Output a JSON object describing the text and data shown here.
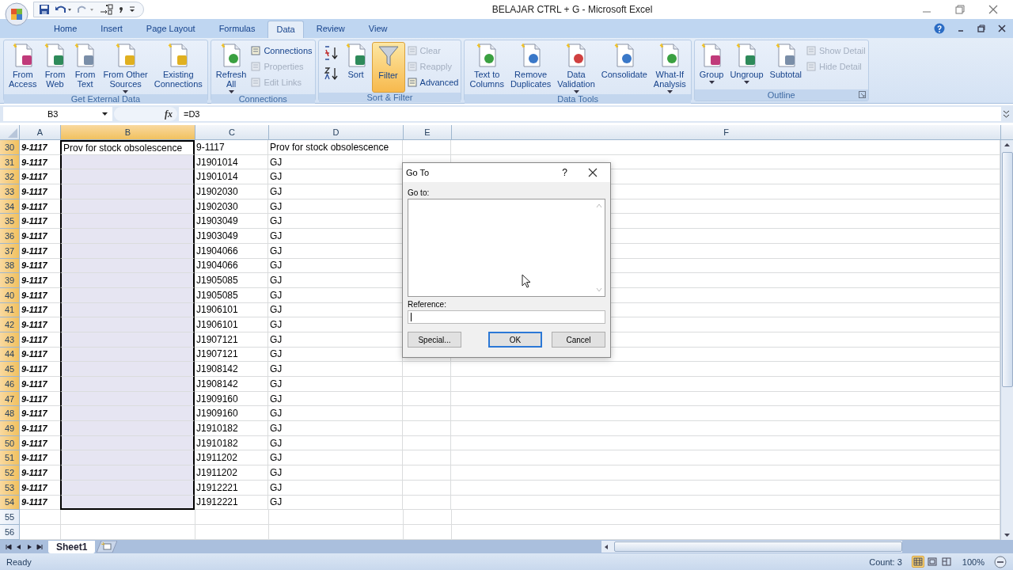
{
  "window": {
    "title": "BELAJAR CTRL + G - Microsoft Excel"
  },
  "tabs": [
    {
      "label": "Home",
      "selected": false
    },
    {
      "label": "Insert",
      "selected": false
    },
    {
      "label": "Page Layout",
      "selected": false
    },
    {
      "label": "Formulas",
      "selected": false
    },
    {
      "label": "Data",
      "selected": true
    },
    {
      "label": "Review",
      "selected": false
    },
    {
      "label": "View",
      "selected": false
    }
  ],
  "ribbon": [
    {
      "name": "Get External Data",
      "launcher": false,
      "items": [
        {
          "kind": "large",
          "lines": [
            "From",
            "Access"
          ],
          "dropdown": false
        },
        {
          "kind": "large",
          "lines": [
            "From",
            "Web"
          ],
          "dropdown": false
        },
        {
          "kind": "large",
          "lines": [
            "From",
            "Text"
          ],
          "dropdown": false
        },
        {
          "kind": "large",
          "lines": [
            "From Other",
            "Sources"
          ],
          "dropdown": true
        },
        {
          "kind": "large",
          "lines": [
            "Existing",
            "Connections"
          ],
          "dropdown": false
        }
      ]
    },
    {
      "name": "Connections",
      "launcher": false,
      "items": [
        {
          "kind": "large",
          "lines": [
            "Refresh",
            "All"
          ],
          "dropdown": true
        },
        {
          "kind": "stack",
          "entries": [
            {
              "label": "Connections",
              "disabled": false
            },
            {
              "label": "Properties",
              "disabled": true
            },
            {
              "label": "Edit Links",
              "disabled": true
            }
          ]
        }
      ]
    },
    {
      "name": "Sort & Filter",
      "launcher": false,
      "items": [
        {
          "kind": "sortpair"
        },
        {
          "kind": "large",
          "lines": [
            "Sort"
          ],
          "dropdown": false
        },
        {
          "kind": "toggle",
          "label": "Filter",
          "on": true
        },
        {
          "kind": "stack",
          "entries": [
            {
              "label": "Clear",
              "disabled": true
            },
            {
              "label": "Reapply",
              "disabled": true
            },
            {
              "label": "Advanced",
              "disabled": false
            }
          ]
        }
      ]
    },
    {
      "name": "Data Tools",
      "launcher": false,
      "items": [
        {
          "kind": "large",
          "lines": [
            "Text to",
            "Columns"
          ],
          "dropdown": false
        },
        {
          "kind": "large",
          "lines": [
            "Remove",
            "Duplicates"
          ],
          "dropdown": false
        },
        {
          "kind": "large",
          "lines": [
            "Data",
            "Validation"
          ],
          "dropdown": true
        },
        {
          "kind": "large",
          "lines": [
            "Consolidate"
          ],
          "dropdown": false
        },
        {
          "kind": "large",
          "lines": [
            "What-If",
            "Analysis"
          ],
          "dropdown": true
        }
      ]
    },
    {
      "name": "Outline",
      "launcher": true,
      "items": [
        {
          "kind": "large",
          "lines": [
            "Group"
          ],
          "dropdown": true
        },
        {
          "kind": "large",
          "lines": [
            "Ungroup"
          ],
          "dropdown": true
        },
        {
          "kind": "large",
          "lines": [
            "Subtotal"
          ],
          "dropdown": false
        },
        {
          "kind": "stack",
          "entries": [
            {
              "label": "Show Detail",
              "disabled": true
            },
            {
              "label": "Hide Detail",
              "disabled": true
            }
          ]
        }
      ]
    }
  ],
  "formula_bar": {
    "name_box": "B3",
    "fx": "fx",
    "formula": "=D3"
  },
  "columns": [
    {
      "label": "A",
      "selected": false
    },
    {
      "label": "B",
      "selected": true
    },
    {
      "label": "C",
      "selected": false
    },
    {
      "label": "D",
      "selected": false
    },
    {
      "label": "E",
      "selected": false
    },
    {
      "label": "F",
      "selected": false
    }
  ],
  "rows": [
    {
      "number": "30",
      "selected": true,
      "cells": [
        "9-1117",
        "Prov for stock obsolescence",
        "9-1117",
        "Prov for stock obsolescence"
      ]
    },
    {
      "number": "31",
      "selected": true,
      "cells": [
        "9-1117",
        "",
        "J1901014",
        "GJ"
      ]
    },
    {
      "number": "32",
      "selected": true,
      "cells": [
        "9-1117",
        "",
        "J1901014",
        "GJ"
      ]
    },
    {
      "number": "33",
      "selected": true,
      "cells": [
        "9-1117",
        "",
        "J1902030",
        "GJ"
      ]
    },
    {
      "number": "34",
      "selected": true,
      "cells": [
        "9-1117",
        "",
        "J1902030",
        "GJ"
      ]
    },
    {
      "number": "35",
      "selected": true,
      "cells": [
        "9-1117",
        "",
        "J1903049",
        "GJ"
      ]
    },
    {
      "number": "36",
      "selected": true,
      "cells": [
        "9-1117",
        "",
        "J1903049",
        "GJ"
      ]
    },
    {
      "number": "37",
      "selected": true,
      "cells": [
        "9-1117",
        "",
        "J1904066",
        "GJ"
      ]
    },
    {
      "number": "38",
      "selected": true,
      "cells": [
        "9-1117",
        "",
        "J1904066",
        "GJ"
      ]
    },
    {
      "number": "39",
      "selected": true,
      "cells": [
        "9-1117",
        "",
        "J1905085",
        "GJ"
      ]
    },
    {
      "number": "40",
      "selected": true,
      "cells": [
        "9-1117",
        "",
        "J1905085",
        "GJ"
      ]
    },
    {
      "number": "41",
      "selected": true,
      "cells": [
        "9-1117",
        "",
        "J1906101",
        "GJ"
      ]
    },
    {
      "number": "42",
      "selected": true,
      "cells": [
        "9-1117",
        "",
        "J1906101",
        "GJ"
      ]
    },
    {
      "number": "43",
      "selected": true,
      "cells": [
        "9-1117",
        "",
        "J1907121",
        "GJ"
      ]
    },
    {
      "number": "44",
      "selected": true,
      "cells": [
        "9-1117",
        "",
        "J1907121",
        "GJ"
      ]
    },
    {
      "number": "45",
      "selected": true,
      "cells": [
        "9-1117",
        "",
        "J1908142",
        "GJ"
      ]
    },
    {
      "number": "46",
      "selected": true,
      "cells": [
        "9-1117",
        "",
        "J1908142",
        "GJ"
      ]
    },
    {
      "number": "47",
      "selected": true,
      "cells": [
        "9-1117",
        "",
        "J1909160",
        "GJ"
      ]
    },
    {
      "number": "48",
      "selected": true,
      "cells": [
        "9-1117",
        "",
        "J1909160",
        "GJ"
      ]
    },
    {
      "number": "49",
      "selected": true,
      "cells": [
        "9-1117",
        "",
        "J1910182",
        "GJ"
      ]
    },
    {
      "number": "50",
      "selected": true,
      "cells": [
        "9-1117",
        "",
        "J1910182",
        "GJ"
      ]
    },
    {
      "number": "51",
      "selected": true,
      "cells": [
        "9-1117",
        "",
        "J1911202",
        "GJ"
      ]
    },
    {
      "number": "52",
      "selected": true,
      "cells": [
        "9-1117",
        "",
        "J1911202",
        "GJ"
      ]
    },
    {
      "number": "53",
      "selected": true,
      "cells": [
        "9-1117",
        "",
        "J1912221",
        "GJ"
      ]
    },
    {
      "number": "54",
      "selected": true,
      "cells": [
        "9-1117",
        "",
        "J1912221",
        "GJ"
      ]
    },
    {
      "number": "55",
      "selected": false,
      "cells": []
    },
    {
      "number": "56",
      "selected": false,
      "cells": []
    }
  ],
  "dialog": {
    "title": "Go To",
    "help": "?",
    "list_label": "Go to:",
    "reference_label": "Reference:",
    "buttons": [
      {
        "label": "Special...",
        "default": false
      },
      {
        "label": "OK",
        "default": true
      },
      {
        "label": "Cancel",
        "default": false
      }
    ]
  },
  "sheet_tabs": [
    {
      "label": "Sheet1",
      "selected": true
    }
  ],
  "status_bar": {
    "mode": "Ready",
    "count": "Count: 3",
    "zoom": "100%",
    "views": [
      {
        "selected": true
      },
      {
        "selected": false
      },
      {
        "selected": false
      }
    ]
  }
}
